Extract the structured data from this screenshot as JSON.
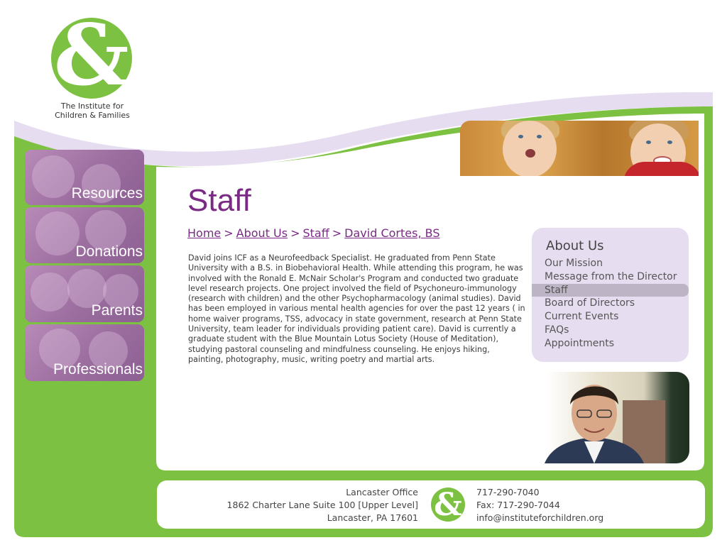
{
  "logo": {
    "symbol": "&",
    "line1": "The Institute for",
    "line2": "Children & Families"
  },
  "nav": [
    {
      "label": "Resources"
    },
    {
      "label": "Donations"
    },
    {
      "label": "Parents"
    },
    {
      "label": "Professionals"
    }
  ],
  "page": {
    "title": "Staff",
    "bio": "David joins ICF as a Neurofeedback Specialist. He graduated from Penn State University with a B.S. in Biobehavioral Health. While attending this program, he was involved with the Ronald E. McNair Scholar's Program and conducted two graduate level research projects. One project involved the field of Psychoneuro-immunology (research with children) and the other Psychopharmacology (animal studies). David has been employed in various mental health agencies for over the past 12 years ( in home waiver programs, TSS, advocacy in state government, research at Penn State University, team leader for individuals providing patient care). David is currently a graduate student with the Blue Mountain Lotus Society (House of Meditation), studying pastoral counseling and mindfulness counseling. He enjoys hiking, painting, photography, music, writing poetry and martial arts."
  },
  "breadcrumb": {
    "items": [
      "Home",
      "About Us",
      "Staff",
      "David Cortes, BS"
    ],
    "separator": ">"
  },
  "sidebar": {
    "title": "About Us",
    "links": [
      "Our Mission",
      "Message from the Director",
      "Staff",
      "Board of Directors",
      "Current Events",
      "FAQs",
      "Appointments"
    ],
    "active": "Staff"
  },
  "footer": {
    "office": "Lancaster Office",
    "address": "1862 Charter Lane Suite 100 [Upper Level]",
    "city": "Lancaster, PA 17601",
    "phone": "717-290-7040",
    "fax": "Fax: 717-290-7044",
    "email": "info@instituteforchildren.org",
    "logo_symbol": "&"
  },
  "colors": {
    "brand_green": "#7dc142",
    "brand_purple": "#7a2a84",
    "lavender": "#e6def0",
    "active_item": "#bdb4c6"
  }
}
